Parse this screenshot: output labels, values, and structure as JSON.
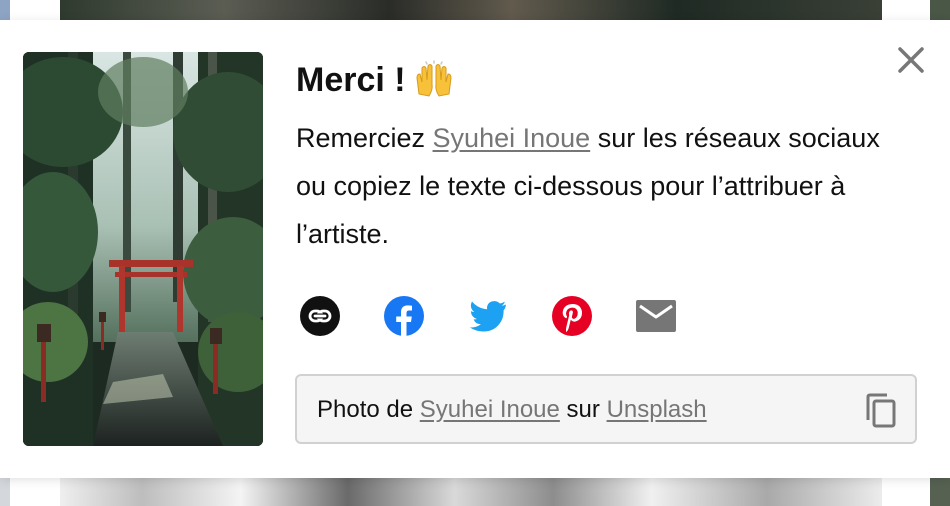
{
  "modal": {
    "title": "Merci !",
    "title_emoji": "raising-hands-emoji",
    "desc_before": "Remerciez",
    "photographer": "Syuhei Inoue",
    "desc_after": "sur les réseaux sociaux ou copiez le texte ci-dessous pour l’attribuer à l’artiste.",
    "close_icon": "close-icon"
  },
  "share": [
    {
      "name": "link-icon",
      "color": "#111111"
    },
    {
      "name": "facebook-icon",
      "color": "#1877f2"
    },
    {
      "name": "twitter-icon",
      "color": "#1da1f2"
    },
    {
      "name": "pinterest-icon",
      "color": "#e60023"
    },
    {
      "name": "email-icon",
      "color": "#767676"
    }
  ],
  "credit": {
    "prefix": "Photo de",
    "photographer": "Syuhei Inoue",
    "middle": "sur",
    "site": "Unsplash",
    "copy_icon": "copy-icon"
  }
}
